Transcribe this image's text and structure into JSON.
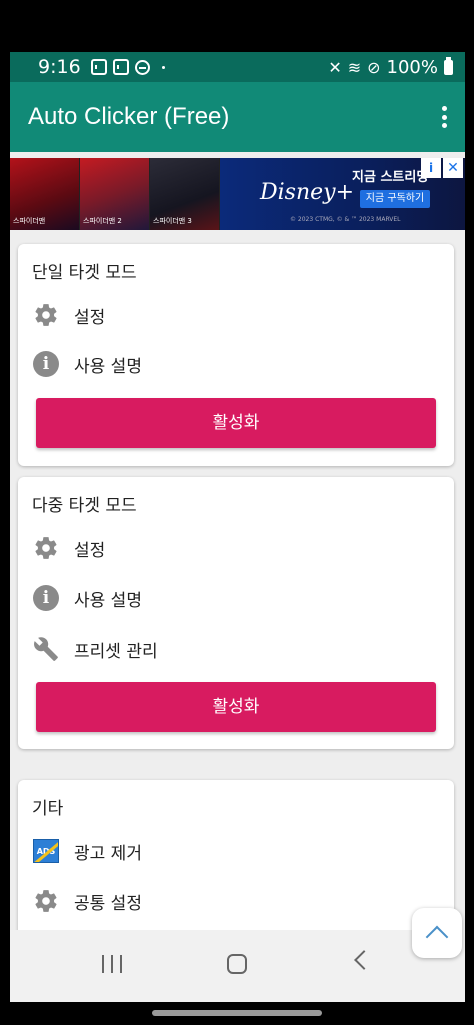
{
  "status_bar": {
    "time": "9:16",
    "battery": "100%",
    "icons": [
      "screen-mirror-icon",
      "screen-mirror-icon",
      "do-not-disturb-icon",
      "dot-icon",
      "mute-icon",
      "wifi-icon",
      "blocked-icon",
      "battery-icon"
    ]
  },
  "app_bar": {
    "title": "Auto Clicker (Free)",
    "menu_icon": "more-vert-icon"
  },
  "ad": {
    "poster_captions": [
      "스파이더맨",
      "스파이더맨 2",
      "스파이더맨 3"
    ],
    "brand": "Disney+",
    "headline": "지금 스트리밍",
    "cta": "지금 구독하기",
    "legal": "© 2023 CTMG, © & ™ 2023 MARVEL",
    "info_icon": "i",
    "close_icon": "✕"
  },
  "single_target": {
    "title": "단일 타겟 모드",
    "settings_label": "설정",
    "help_label": "사용 설명",
    "activate_label": "활성화"
  },
  "multi_target": {
    "title": "다중 타겟 모드",
    "settings_label": "설정",
    "help_label": "사용 설명",
    "preset_label": "프리셋 관리",
    "activate_label": "활성화"
  },
  "misc": {
    "title": "기타",
    "remove_ads_label": "광고 제거",
    "ads_icon_text": "ADS",
    "common_settings_label": "공통 설정"
  },
  "colors": {
    "status_bar": "#0a6b5c",
    "app_bar": "#118a77",
    "accent_button": "#d81b60",
    "background": "#eeeeee"
  }
}
